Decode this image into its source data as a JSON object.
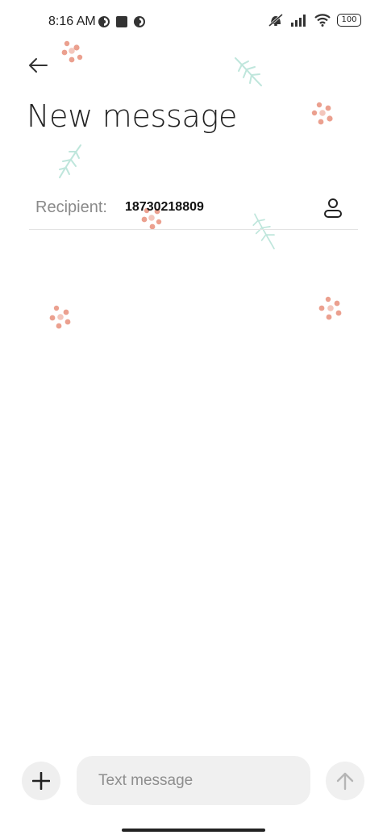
{
  "status_bar": {
    "time": "8:16 AM",
    "left_icons": [
      "app-notification-icon",
      "square-notification-icon",
      "app-notification-icon"
    ],
    "right_icons": [
      "vibrate-off-icon",
      "signal-icon",
      "wifi-icon"
    ],
    "battery_level": "100"
  },
  "header": {
    "back_icon": "back-arrow-icon",
    "title": "New message"
  },
  "recipient": {
    "label": "Recipient:",
    "value": "18730218809",
    "contact_icon": "contact-icon"
  },
  "composer": {
    "attach_icon": "plus-icon",
    "placeholder": "Text message",
    "value": "",
    "send_icon": "arrow-up-icon"
  },
  "colors": {
    "background": "#ffffff",
    "flower": "#e8907c",
    "leaf": "#bfe6dc",
    "input_bg": "#f0f0f0",
    "divider": "#e3e3e3"
  }
}
